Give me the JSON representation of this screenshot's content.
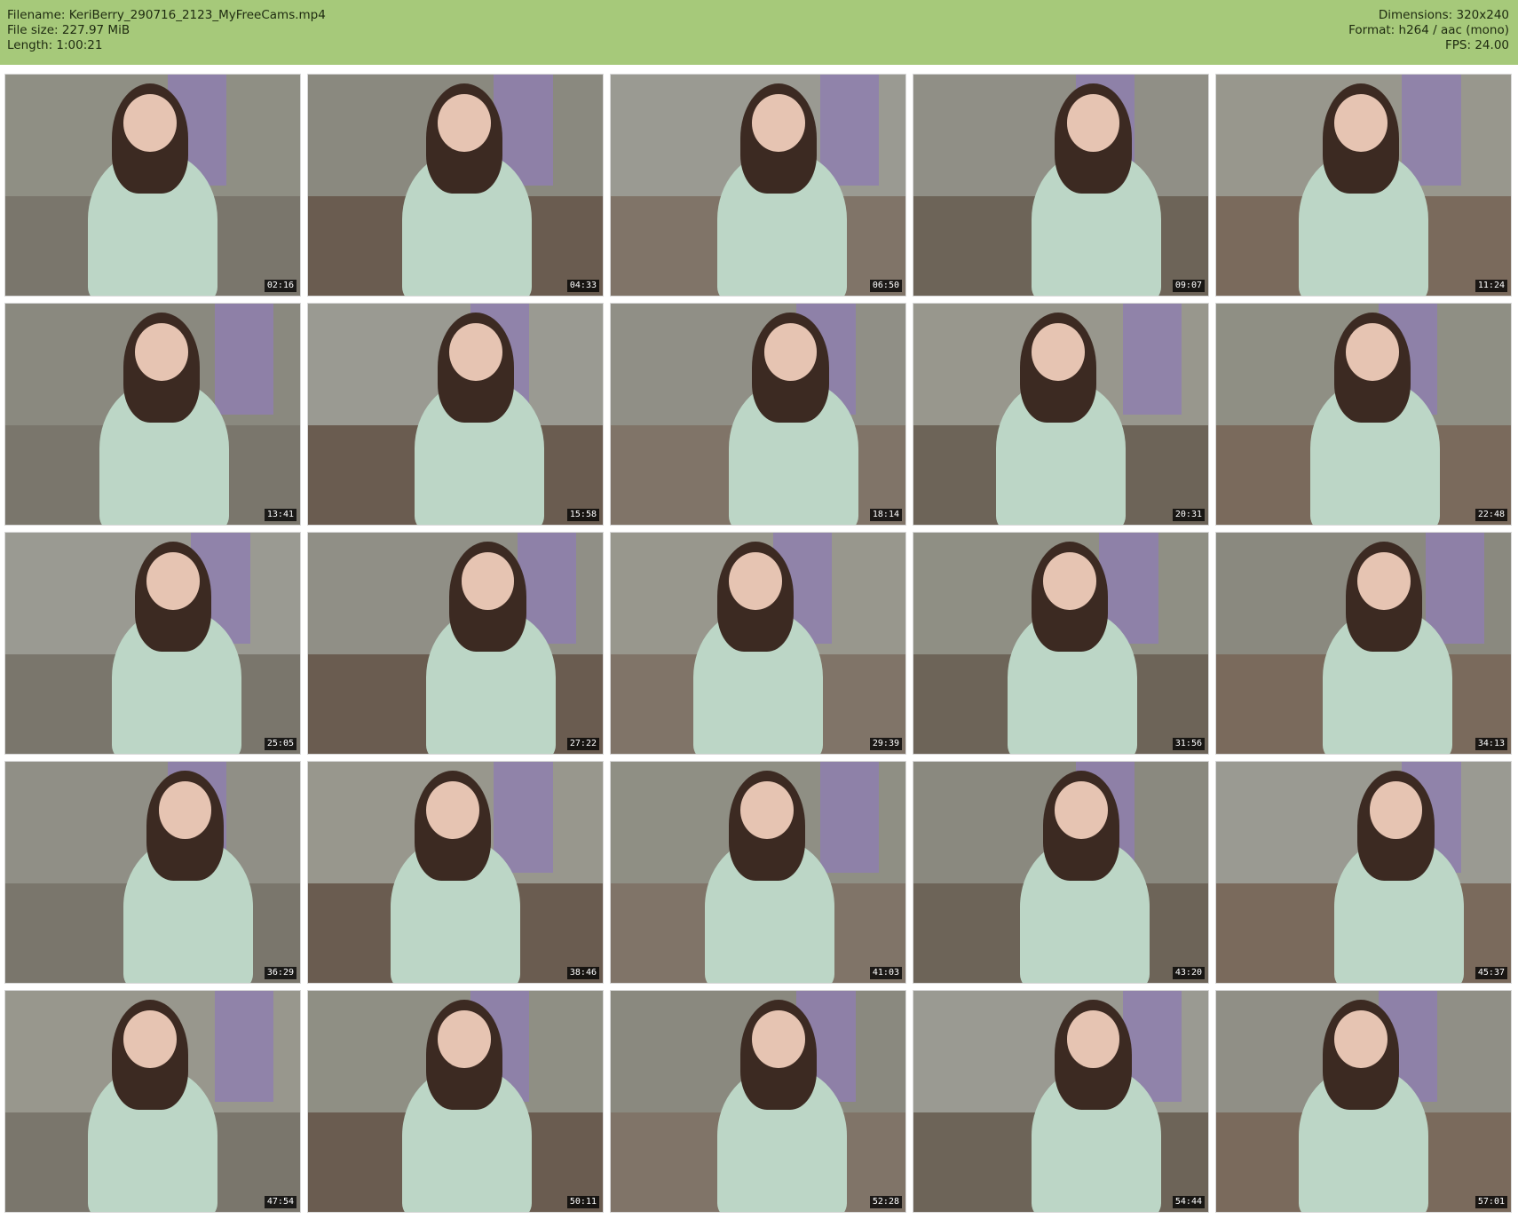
{
  "header": {
    "filename_line": "Filename: KeriBerry_290716_2123_MyFreeCams.mp4",
    "filesize_line": "File size: 227.97 MiB",
    "length_line": "Length: 1:00:21",
    "dimensions_line": "Dimensions: 320x240",
    "format_line": "Format: h264 / aac (mono)",
    "fps_line": "FPS: 24.00"
  },
  "colors": {
    "header_bg": "#a6c97a",
    "timestamp_bg": "#000000"
  },
  "thumbnails": [
    {
      "time": "02:16"
    },
    {
      "time": "04:33"
    },
    {
      "time": "06:50"
    },
    {
      "time": "09:07"
    },
    {
      "time": "11:24"
    },
    {
      "time": "13:41"
    },
    {
      "time": "15:58"
    },
    {
      "time": "18:14"
    },
    {
      "time": "20:31"
    },
    {
      "time": "22:48"
    },
    {
      "time": "25:05"
    },
    {
      "time": "27:22"
    },
    {
      "time": "29:39"
    },
    {
      "time": "31:56"
    },
    {
      "time": "34:13"
    },
    {
      "time": "36:29"
    },
    {
      "time": "38:46"
    },
    {
      "time": "41:03"
    },
    {
      "time": "43:20"
    },
    {
      "time": "45:37"
    },
    {
      "time": "47:54"
    },
    {
      "time": "50:11"
    },
    {
      "time": "52:28"
    },
    {
      "time": "54:44"
    },
    {
      "time": "57:01"
    }
  ]
}
